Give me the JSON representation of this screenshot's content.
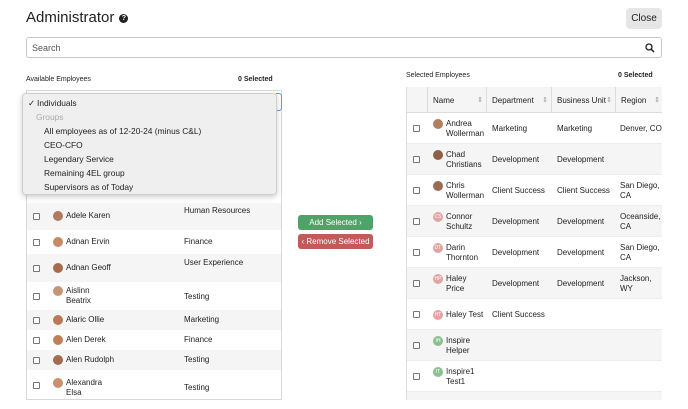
{
  "header": {
    "title": "Administrator",
    "close_label": "Close"
  },
  "search": {
    "placeholder": "Search"
  },
  "available": {
    "label": "Available Employees",
    "selected_count": "0 Selected"
  },
  "selected": {
    "label": "Selected Employees",
    "selected_count": "0 Selected"
  },
  "dropdown": {
    "checked_option": "Individuals",
    "group_header": "Groups",
    "options": [
      "All employees as of 12-20-24 (minus C&L)",
      "CEO-CFO",
      "Legendary Service",
      "Remaining 4EL group",
      "Supervisors as of Today"
    ]
  },
  "buttons": {
    "add": "Add Selected ›",
    "remove": "‹ Remove Selected"
  },
  "left_rows": [
    {
      "name": "Adele Karen",
      "dept": "Human Resources"
    },
    {
      "name": "Adnan Ervin",
      "dept": "Finance"
    },
    {
      "name": "Adnan Geoff",
      "dept": "User Experience"
    },
    {
      "name": "Aislinn Beatrix",
      "dept": "Testing"
    },
    {
      "name": "Alaric Ollie",
      "dept": "Marketing"
    },
    {
      "name": "Alen Derek",
      "dept": "Finance"
    },
    {
      "name": "Alen Rudolph",
      "dept": "Testing"
    },
    {
      "name": "Alexandra Elsa",
      "dept": "Testing"
    }
  ],
  "right_columns": [
    "Name",
    "Department",
    "Business Unit",
    "Region"
  ],
  "right_rows": [
    {
      "name": "Andrea Wollerman",
      "initials": "",
      "dept": "Marketing",
      "bu": "Marketing",
      "region": "Denver, CO"
    },
    {
      "name": "Chad Christians",
      "initials": "",
      "dept": "Development",
      "bu": "Development",
      "region": ""
    },
    {
      "name": "Chris Wollerman",
      "initials": "",
      "dept": "Client Success",
      "bu": "Client Success",
      "region": "San Diego, CA"
    },
    {
      "name": "Connor Schultz",
      "initials": "CS",
      "dept": "Development",
      "bu": "Development",
      "region": "Oceanside, CA"
    },
    {
      "name": "Darin Thornton",
      "initials": "DT",
      "dept": "Development",
      "bu": "Development",
      "region": "San Diego, CA"
    },
    {
      "name": "Haley Price",
      "initials": "HP",
      "dept": "Development",
      "bu": "Development",
      "region": "Jackson, WY"
    },
    {
      "name": "Haley Test",
      "initials": "HT",
      "dept": "Client Success",
      "bu": "",
      "region": ""
    },
    {
      "name": "Inspire Helper",
      "initials": "IH",
      "dept": "",
      "bu": "",
      "region": ""
    },
    {
      "name": "Inspire1 Test1",
      "initials": "IT",
      "dept": "",
      "bu": "",
      "region": ""
    }
  ],
  "colors": {
    "add_button": "#4fa368",
    "remove_button": "#c25a59",
    "initials_pink": "#e3a3a3",
    "initials_green": "#8ac18f"
  }
}
